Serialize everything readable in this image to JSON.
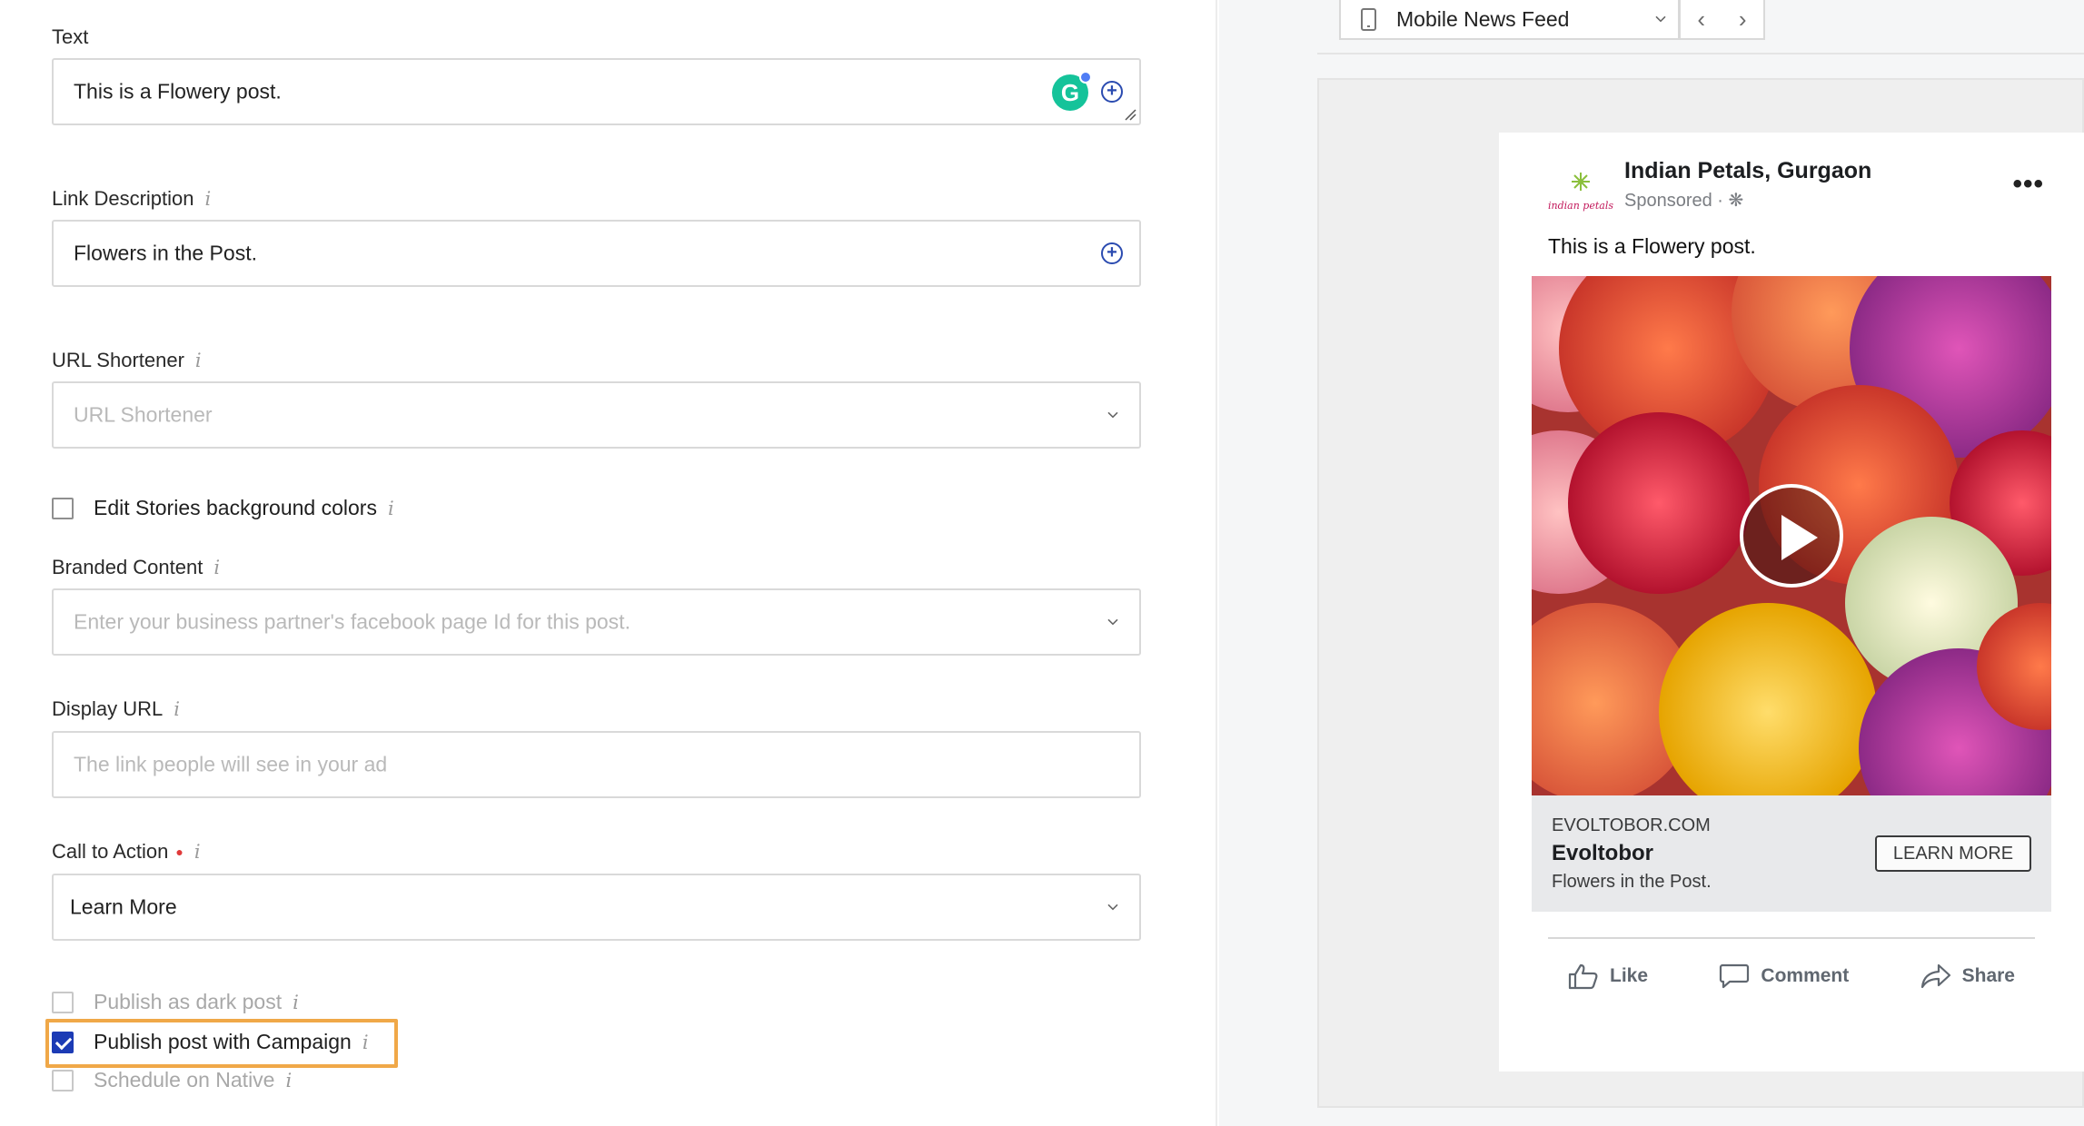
{
  "form": {
    "text": {
      "label": "Text",
      "value": "This is a Flowery post."
    },
    "link_description": {
      "label": "Link Description",
      "value": "Flowers in the Post."
    },
    "url_shortener": {
      "label": "URL Shortener",
      "placeholder": "URL Shortener"
    },
    "edit_stories": {
      "label": "Edit Stories background colors",
      "checked": false
    },
    "branded_content": {
      "label": "Branded Content",
      "placeholder": "Enter your business partner's facebook page Id for this post."
    },
    "display_url": {
      "label": "Display URL",
      "placeholder": "The link people will see in your ad"
    },
    "call_to_action": {
      "label": "Call to Action",
      "value": "Learn More"
    },
    "publish_dark": {
      "label": "Publish as dark post",
      "checked": false
    },
    "publish_campaign": {
      "label": "Publish post with Campaign",
      "checked": true
    },
    "schedule_native": {
      "label": "Schedule on Native",
      "checked": false
    },
    "info_glyph": "i",
    "grammarly_letter": "G"
  },
  "preview": {
    "placement": "Mobile News Feed",
    "nav_prev": "‹",
    "nav_next": "›",
    "page_name": "Indian Petals, Gurgaon",
    "sponsored": "Sponsored · ❋",
    "logo_text": "indian petals",
    "more": "•••",
    "post_text": "This is a Flowery post.",
    "link_domain": "EVOLTOBOR.COM",
    "link_title": "Evoltobor",
    "link_desc": "Flowers in the Post.",
    "cta": "LEARN MORE",
    "actions": {
      "like": "Like",
      "comment": "Comment",
      "share": "Share"
    }
  },
  "colors": {
    "accent": "#1c3bb5",
    "highlight": "#f0a848",
    "grammarly": "#15c39a"
  }
}
